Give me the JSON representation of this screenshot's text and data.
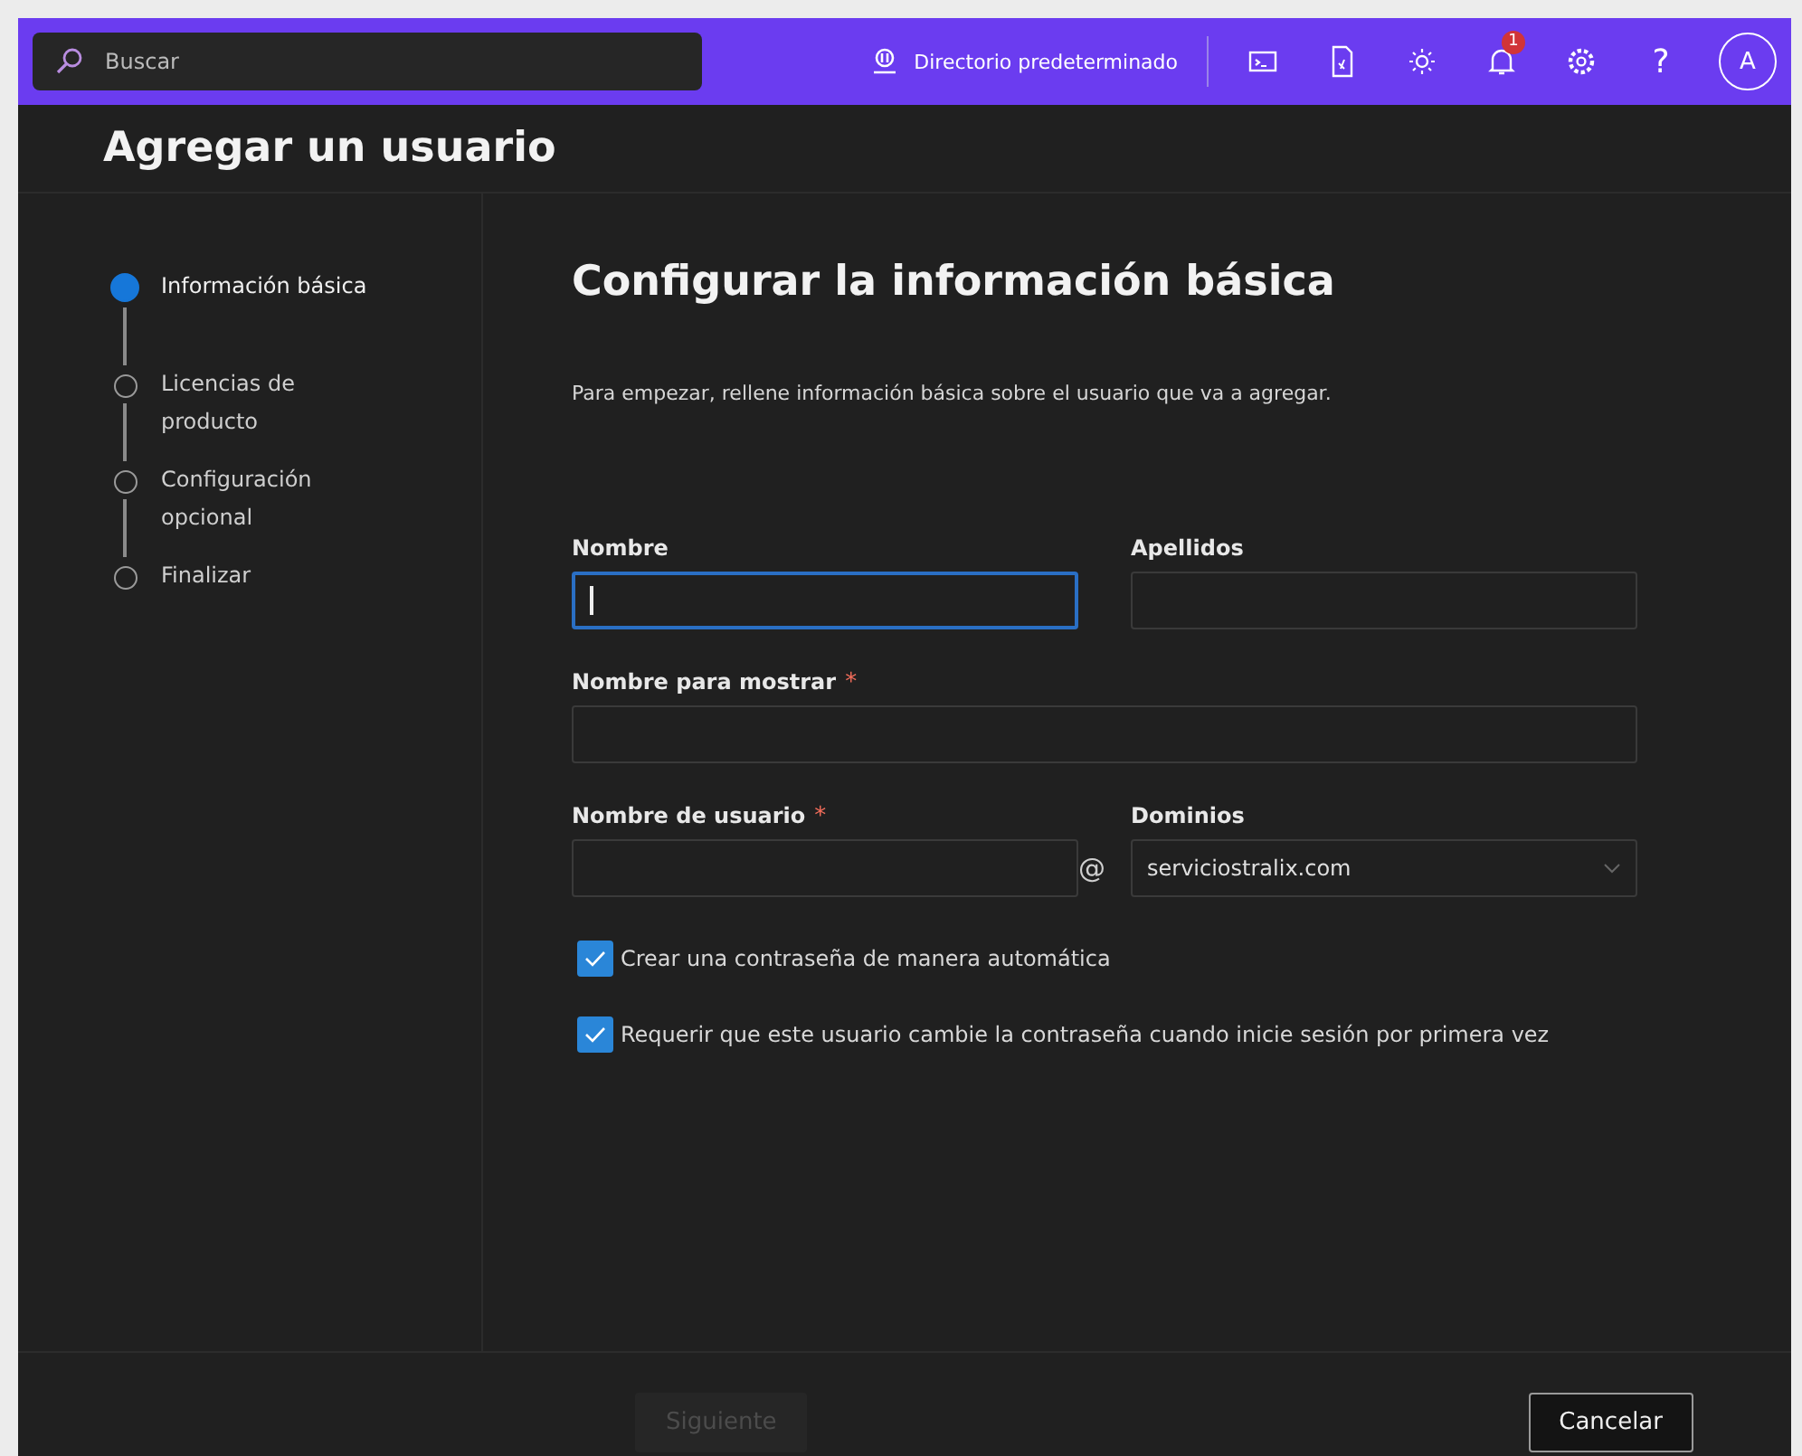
{
  "topbar": {
    "search": {
      "placeholder": "Buscar"
    },
    "directory": "Directorio predeterminado",
    "notification_count": "1",
    "avatar": "A",
    "help": "?"
  },
  "page_title": "Agregar un usuario",
  "steps": [
    {
      "label": "Información básica",
      "selected": true
    },
    {
      "label": "Licencias de producto",
      "selected": false
    },
    {
      "label": "Configuración opcional",
      "selected": false
    },
    {
      "label": "Finalizar",
      "selected": false
    }
  ],
  "section_title": "Configurar la información básica",
  "intro": "Para empezar, rellene información básica sobre el usuario que va a agregar.",
  "fields": {
    "first_name": {
      "label": "Nombre",
      "focused": true
    },
    "last_name": {
      "label": "Apellidos",
      "focused": false
    },
    "display_name": {
      "label": "Nombre para mostrar",
      "required_mark": "*",
      "focused": false
    },
    "user_name": {
      "label": "Nombre de usuario",
      "required_mark": "*",
      "focused": false
    },
    "at_sign": "@",
    "domain": {
      "label": "Dominios",
      "value": "serviciostralix.com"
    }
  },
  "checkboxes": [
    {
      "label": "Crear una contraseña de manera automática",
      "checked": true
    },
    {
      "label": "Requerir que este usuario cambie la contraseña cuando inicie sesión por primera vez",
      "checked": true
    }
  ],
  "footer": {
    "next": {
      "label": "Siguiente",
      "disabled": true
    },
    "cancel": {
      "label": "Cancelar",
      "disabled": false
    }
  }
}
